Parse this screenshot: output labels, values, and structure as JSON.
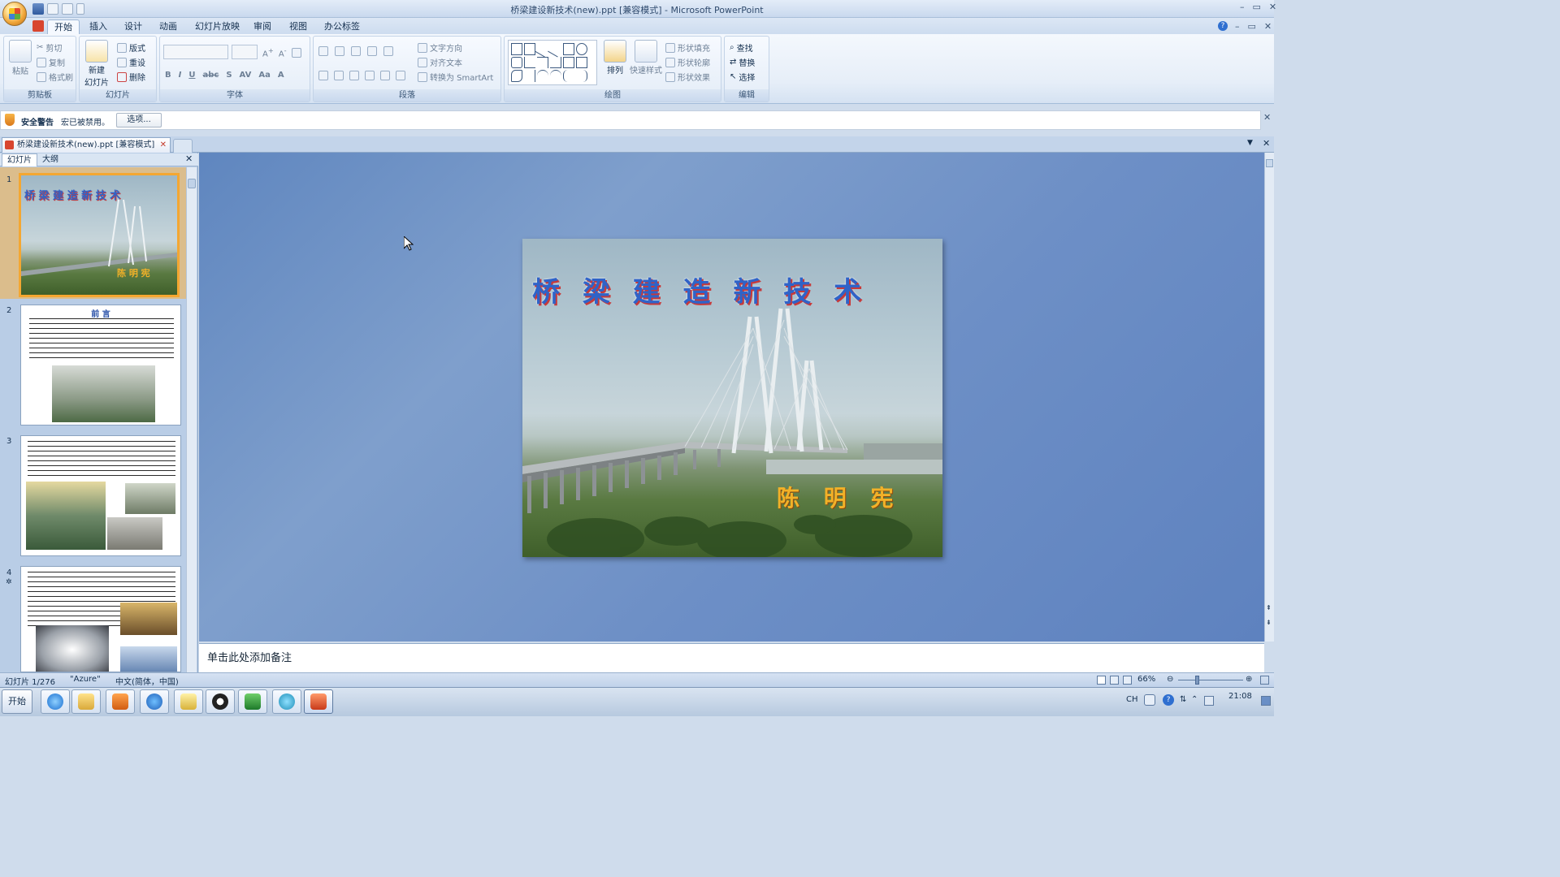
{
  "window": {
    "title": "桥梁建设新技术(new).ppt [兼容模式] - Microsoft PowerPoint"
  },
  "ribbon_tabs": [
    {
      "label": "开始",
      "active": true
    },
    {
      "label": "插入"
    },
    {
      "label": "设计"
    },
    {
      "label": "动画"
    },
    {
      "label": "幻灯片放映"
    },
    {
      "label": "审阅"
    },
    {
      "label": "视图"
    },
    {
      "label": "办公标签"
    }
  ],
  "ribbon": {
    "clipboard": {
      "label": "剪贴板",
      "paste": "粘贴",
      "cut": "剪切",
      "copy": "复制",
      "format_painter": "格式刷"
    },
    "slides": {
      "label": "幻灯片",
      "new_slide": "新建\n幻灯片",
      "layout": "版式",
      "reset": "重设",
      "delete": "删除"
    },
    "font": {
      "label": "字体"
    },
    "paragraph": {
      "label": "段落",
      "text_direction": "文字方向",
      "align_text": "对齐文本",
      "convert_smartart": "转换为 SmartArt"
    },
    "drawing": {
      "label": "绘图",
      "arrange": "排列",
      "quick_styles": "快速样式",
      "shape_fill": "形状填充",
      "shape_outline": "形状轮廓",
      "shape_effects": "形状效果"
    },
    "editing": {
      "label": "编辑",
      "find": "查找",
      "replace": "替换",
      "select": "选择"
    }
  },
  "security_bar": {
    "title": "安全警告",
    "message": "宏已被禁用。",
    "options_button": "选项..."
  },
  "document_tab": {
    "label": "桥梁建设新技术(new).ppt [兼容模式]"
  },
  "slide_pane": {
    "tabs": [
      "幻灯片",
      "大纲"
    ],
    "thumbnails": [
      {
        "num": "1",
        "title": "桥 梁 建 造 新 技 术",
        "author": "陈 明 宪"
      },
      {
        "num": "2",
        "title": "前 言"
      },
      {
        "num": "3"
      },
      {
        "num": "4"
      }
    ]
  },
  "slide": {
    "title": "桥 梁 建 造 新 技 术",
    "author": "陈 明 宪"
  },
  "notes": {
    "placeholder": "单击此处添加备注"
  },
  "status": {
    "slide_index": "幻灯片 1/276",
    "theme": "\"Azure\"",
    "language": "中文(简体，中国)",
    "zoom": "66%"
  },
  "taskbar": {
    "start": "开始",
    "tray_lang": "CH",
    "clock_time": "21:08"
  }
}
